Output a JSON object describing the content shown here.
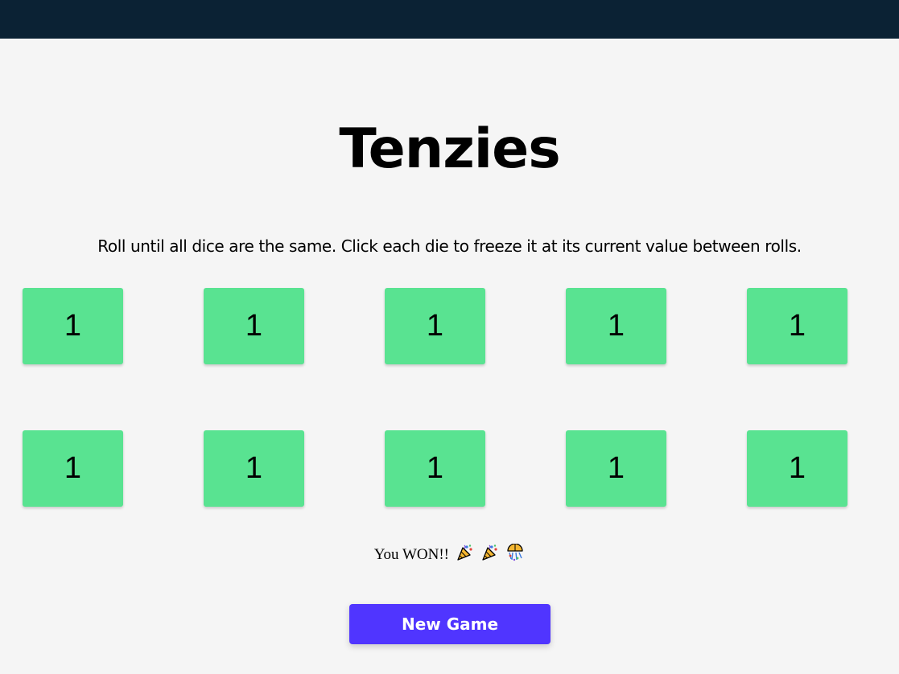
{
  "app": {
    "title": "Tenzies",
    "instructions": "Roll until all dice are the same. Click each die to freeze it at its current value between rolls.",
    "win_message": "You WON!!",
    "win_emojis": [
      "party-popper-icon",
      "party-popper-icon",
      "confetti-ball-icon"
    ],
    "button_label": "New Game"
  },
  "dice": [
    {
      "value": "1",
      "held": true
    },
    {
      "value": "1",
      "held": true
    },
    {
      "value": "1",
      "held": true
    },
    {
      "value": "1",
      "held": true
    },
    {
      "value": "1",
      "held": true
    },
    {
      "value": "1",
      "held": true
    },
    {
      "value": "1",
      "held": true
    },
    {
      "value": "1",
      "held": true
    },
    {
      "value": "1",
      "held": true
    },
    {
      "value": "1",
      "held": true
    }
  ],
  "colors": {
    "top_bar": "#0b2234",
    "background": "#f5f5f5",
    "die_held": "#59e391",
    "die_free": "#ffffff",
    "button": "#5035ff",
    "button_text": "#ffffff"
  }
}
